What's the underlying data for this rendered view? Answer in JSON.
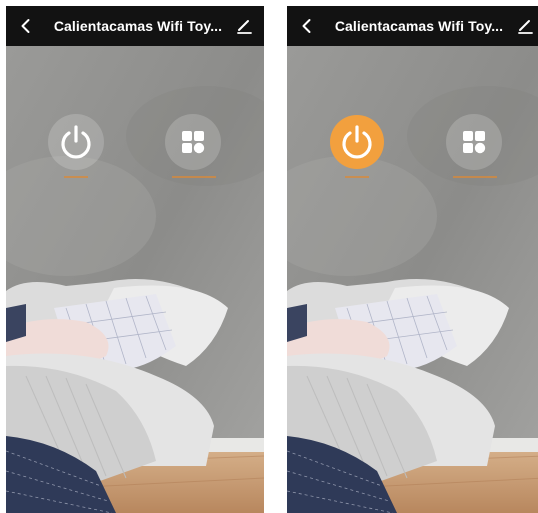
{
  "screens": [
    {
      "state": "off",
      "header": {
        "title": "Calientacamas Wifi Toy..."
      },
      "controls": {
        "power_label": "",
        "mode_label": ""
      },
      "icons": {
        "back": "chevron-left-icon",
        "edit": "pencil-icon",
        "power": "power-icon",
        "mode": "modes-grid-icon"
      },
      "power_on": false
    },
    {
      "state": "on",
      "header": {
        "title": "Calientacamas Wifi Toy..."
      },
      "controls": {
        "power_label": "",
        "mode_label": ""
      },
      "icons": {
        "back": "chevron-left-icon",
        "edit": "pencil-icon",
        "power": "power-icon",
        "mode": "modes-grid-icon"
      },
      "power_on": true
    }
  ],
  "colors": {
    "header_bg": "#121212",
    "accent_orange": "#f2a03e",
    "wall_gray": "#8f8f8d",
    "bedspread_navy": "#2f3a58",
    "floor_wood": "#c8a07a"
  }
}
